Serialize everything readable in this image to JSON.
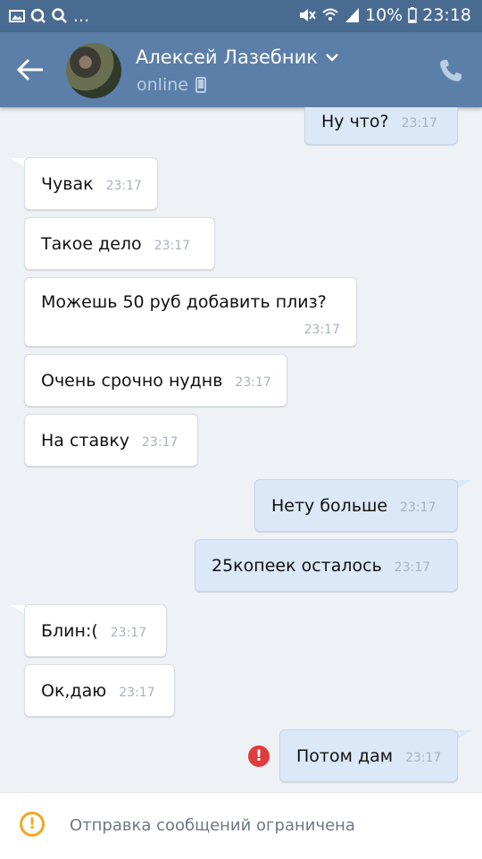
{
  "status_bar": {
    "battery": "10%",
    "time": "23:18",
    "dots": "..."
  },
  "header": {
    "name": "Алексей Лазебник",
    "status": "online"
  },
  "messages": [
    {
      "dir": "out",
      "text": "Ну что?",
      "time": "23:17"
    },
    {
      "dir": "in",
      "text": "Чувак",
      "time": "23:17"
    },
    {
      "dir": "in",
      "text": "Такое дело",
      "time": "23:17"
    },
    {
      "dir": "in",
      "text": "Можешь 50 руб добавить плиз?",
      "time": "23:17"
    },
    {
      "dir": "in",
      "text": "Очень срочно нуднв",
      "time": "23:17"
    },
    {
      "dir": "in",
      "text": "На ставку",
      "time": "23:17"
    },
    {
      "dir": "out",
      "text": "Нету больше",
      "time": "23:17"
    },
    {
      "dir": "out",
      "text": "25копеек осталось",
      "time": "23:17"
    },
    {
      "dir": "in",
      "text": "Блин:(",
      "time": "23:17"
    },
    {
      "dir": "in",
      "text": "Ок,даю",
      "time": "23:17"
    },
    {
      "dir": "out",
      "text": "Потом дам",
      "time": "23:17",
      "failed": true
    }
  ],
  "bottom_notice": "Отправка сообщений ограничена",
  "colors": {
    "status_bar": "#4a6b91",
    "header": "#5b7fa8",
    "outgoing_bubble": "#dbe8f7",
    "incoming_bubble": "#ffffff",
    "error": "#e23b3b",
    "warning": "#f4a623"
  },
  "icons": {
    "back": "arrow-left-icon",
    "call": "phone-icon",
    "dropdown": "chevron-down-icon",
    "status_device": "mobile-icon",
    "send_failed": "error-icon",
    "notice": "warning-icon"
  }
}
